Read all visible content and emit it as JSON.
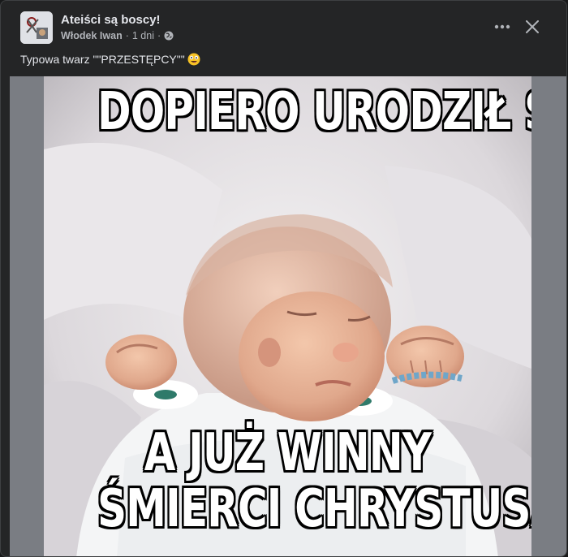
{
  "post": {
    "group_name": "Ateiści są boscy!",
    "author": "Włodek Iwan",
    "separator": "·",
    "time": "1 dni",
    "caption": "Typowa twarz \"\"PRZESTĘPCY\"\"",
    "caption_emoji": "crazy-face-emoji"
  },
  "meme": {
    "top_text": "DOPIERO URODZIŁ SIĘ",
    "bottom_line_1": "A JUŻ WINNY",
    "bottom_line_2": "ŚMIERCI CHRYSTUSA"
  },
  "colors": {
    "card_bg": "#242526",
    "text_primary": "#e4e6eb",
    "text_secondary": "#b0b3b8"
  }
}
